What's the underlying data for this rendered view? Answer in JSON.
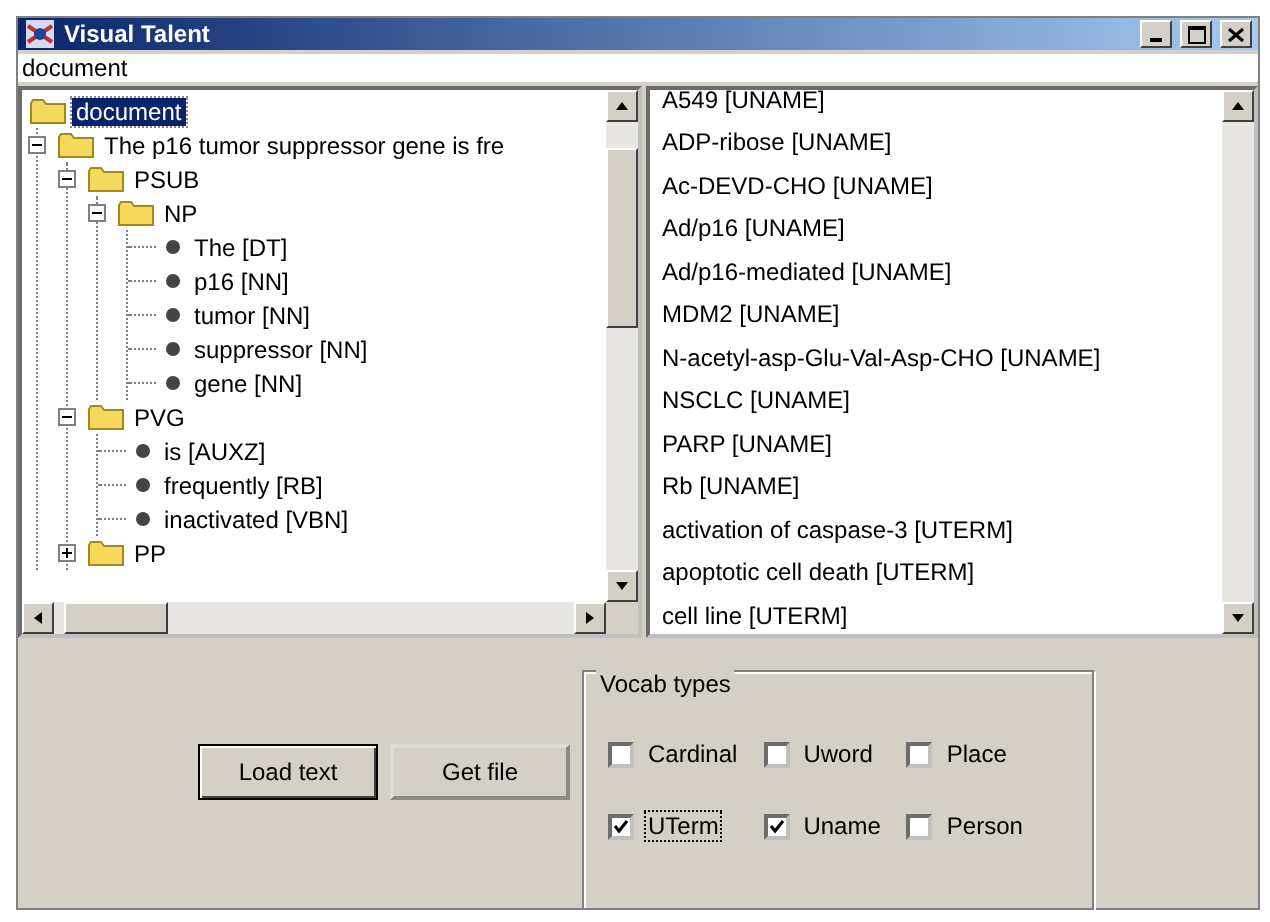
{
  "window": {
    "title": "Visual Talent"
  },
  "path_field": {
    "value": "document"
  },
  "tree": {
    "label": "document",
    "kind": "folder",
    "selected": true,
    "children": [
      {
        "label": "The p16 tumor suppressor gene is fre",
        "kind": "folder",
        "selected": false,
        "expanded": true,
        "children": [
          {
            "label": "PSUB",
            "kind": "folder",
            "selected": false,
            "expanded": true,
            "children": [
              {
                "label": "NP",
                "kind": "folder",
                "selected": false,
                "expanded": true,
                "children": [
                  {
                    "label": "The [DT]",
                    "kind": "leaf",
                    "selected": false
                  },
                  {
                    "label": "p16 [NN]",
                    "kind": "leaf",
                    "selected": false
                  },
                  {
                    "label": "tumor [NN]",
                    "kind": "leaf",
                    "selected": false
                  },
                  {
                    "label": "suppressor [NN]",
                    "kind": "leaf",
                    "selected": false
                  },
                  {
                    "label": "gene [NN]",
                    "kind": "leaf",
                    "selected": false
                  }
                ]
              }
            ]
          },
          {
            "label": "PVG",
            "kind": "folder",
            "selected": false,
            "expanded": true,
            "children": [
              {
                "label": "is [AUXZ]",
                "kind": "leaf",
                "selected": false
              },
              {
                "label": "frequently [RB]",
                "kind": "leaf",
                "selected": false
              },
              {
                "label": "inactivated [VBN]",
                "kind": "leaf",
                "selected": false
              }
            ]
          },
          {
            "label": "PP",
            "kind": "folder",
            "selected": false,
            "expanded": false
          }
        ]
      }
    ]
  },
  "vocab_list": {
    "items": [
      {
        "label": "A549 [UNAME]",
        "selected": false
      },
      {
        "label": "ADP-ribose [UNAME]",
        "selected": false
      },
      {
        "label": "Ac-DEVD-CHO [UNAME]",
        "selected": false
      },
      {
        "label": "Ad/p16 [UNAME]",
        "selected": false
      },
      {
        "label": "Ad/p16-mediated [UNAME]",
        "selected": false
      },
      {
        "label": "MDM2 [UNAME]",
        "selected": false
      },
      {
        "label": "N-acetyl-asp-Glu-Val-Asp-CHO [UNAME]",
        "selected": false
      },
      {
        "label": "NSCLC [UNAME]",
        "selected": false
      },
      {
        "label": "PARP [UNAME]",
        "selected": false
      },
      {
        "label": "Rb [UNAME]",
        "selected": false
      },
      {
        "label": "activation of caspase-3 [UTERM]",
        "selected": false
      },
      {
        "label": "apoptotic cell death [UTERM]",
        "selected": false
      },
      {
        "label": "cell line [UTERM]",
        "selected": false
      }
    ]
  },
  "buttons": [
    "Load text",
    "Get file"
  ],
  "vocab_types": {
    "title": "Vocab types",
    "options": [
      {
        "label": "Cardinal",
        "checked": false,
        "focused": false
      },
      {
        "label": "Uword",
        "checked": false,
        "focused": false
      },
      {
        "label": "Place",
        "checked": false,
        "focused": false
      },
      {
        "label": "UTerm",
        "checked": true,
        "focused": true
      },
      {
        "label": "Uname",
        "checked": true,
        "focused": false
      },
      {
        "label": "Person",
        "checked": false,
        "focused": false
      }
    ]
  }
}
